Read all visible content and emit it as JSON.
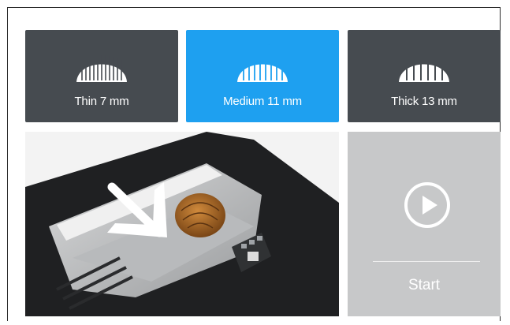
{
  "slice_options": [
    {
      "label": "Thin 7 mm",
      "selected": false,
      "icon": "bread-slices-icon"
    },
    {
      "label": "Medium 11 mm",
      "selected": true,
      "icon": "bread-slices-icon"
    },
    {
      "label": "Thick 13 mm",
      "selected": false,
      "icon": "bread-slices-icon"
    }
  ],
  "start": {
    "label": "Start",
    "icon": "play-circle-icon"
  },
  "colors": {
    "tile_default": "#464b50",
    "tile_selected": "#1ea0f0",
    "start_panel": "#c7c8c9"
  }
}
